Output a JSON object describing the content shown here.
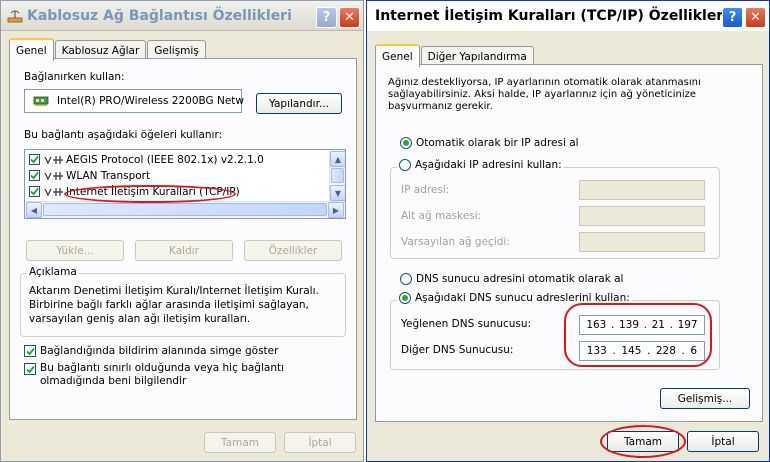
{
  "left": {
    "title": "Kablosuz Ağ Bağlantısı Özellikleri",
    "tabs": [
      "Genel",
      "Kablosuz Ağlar",
      "Gelişmiş"
    ],
    "connect_using_label": "Bağlanırken kullan:",
    "adapter_name": "Intel(R) PRO/Wireless 2200BG Netw",
    "configure_button": "Yapılandır...",
    "items_label": "Bu bağlantı aşağıdaki öğeleri kullanır:",
    "items": [
      "AEGIS Protocol (IEEE 802.1x) v2.2.1.0",
      "WLAN Transport",
      "Internet İletişim Kuralları (TCP/IP)"
    ],
    "install_button": "Yükle...",
    "uninstall_button": "Kaldır",
    "properties_button": "Özellikler",
    "description_label": "Açıklama",
    "description_text": "Aktarım Denetimi İletişim Kuralı/Internet İletişim Kuralı. Birbirine bağlı farklı ağlar arasında iletişimi sağlayan, varsayılan geniş alan ağı iletişim kuralları.",
    "notify_icon_label": "Bağlandığında bildirim alanında simge göster",
    "notify_limited_label": "Bu bağlantı sınırlı olduğunda veya hiç bağlantı olmadığında beni bilgilendir",
    "ok_button": "Tamam",
    "cancel_button": "İptal"
  },
  "right": {
    "title": "Internet İletişim Kuralları (TCP/IP) Özellikleri",
    "tabs": [
      "Genel",
      "Diğer Yapılandırma"
    ],
    "intro_text": "Ağınız destekliyorsa, IP ayarlarının otomatik olarak atanmasını sağlayabilirsiniz. Aksi halde, IP ayarlarınız için ağ yöneticinize başvurmanız gerekir.",
    "auto_ip_label": "Otomatik olarak bir IP adresi al",
    "manual_ip_label": "Aşağıdaki IP adresini kullan:",
    "ip_address_label": "IP adresi:",
    "subnet_label": "Alt ağ maskesi:",
    "gateway_label": "Varsayılan ağ geçidi:",
    "auto_dns_label": "DNS sunucu adresini otomatik olarak al",
    "manual_dns_label": "Aşağıdaki DNS sunucu adreslerini kullan:",
    "preferred_dns_label": "Yeğlenen DNS sunucusu:",
    "preferred_dns": [
      "163",
      "139",
      "21",
      "197"
    ],
    "alternate_dns_label": "Diğer DNS Sunucusu:",
    "alternate_dns": [
      "133",
      "145",
      "228",
      "6"
    ],
    "advanced_button": "Gelişmiş...",
    "ok_button": "Tamam",
    "cancel_button": "İptal"
  },
  "colors": {
    "dialog_bg": "#ece9d8",
    "panel_bg": "#fcfcfe",
    "annotation": "#d8181f",
    "title_inactive": "#7a96b8"
  }
}
